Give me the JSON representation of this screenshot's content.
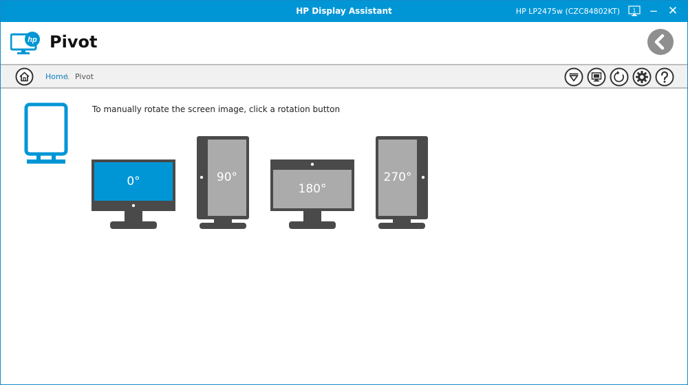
{
  "app": {
    "title": "HP Display Assistant",
    "monitor_name": "HP LP2475w (CZC84802KT)",
    "monitor_icon_number": "1",
    "minimize_glyph": "−",
    "close_glyph": "✕"
  },
  "header": {
    "page_title": "Pivot",
    "logo_text": "hp"
  },
  "breadcrumb": {
    "home": "Home",
    "separator": "\\",
    "current": "Pivot"
  },
  "toolbar": {
    "icons": [
      "menu-dropdown-icon",
      "screen-capture-icon",
      "refresh-icon",
      "settings-icon",
      "help-icon"
    ]
  },
  "main": {
    "instruction": "To manually rotate the screen image, click a rotation button",
    "rotations": [
      {
        "label": "0°",
        "selected": true
      },
      {
        "label": "90°",
        "selected": false
      },
      {
        "label": "180°",
        "selected": false
      },
      {
        "label": "270°",
        "selected": false
      }
    ]
  },
  "colors": {
    "brand_blue": "#0096d6",
    "monitor_dark": "#4a4a4a",
    "screen_gray": "#ababab",
    "screen_selected": "#0096d6",
    "back_button_gray": "#8f8f8f"
  }
}
